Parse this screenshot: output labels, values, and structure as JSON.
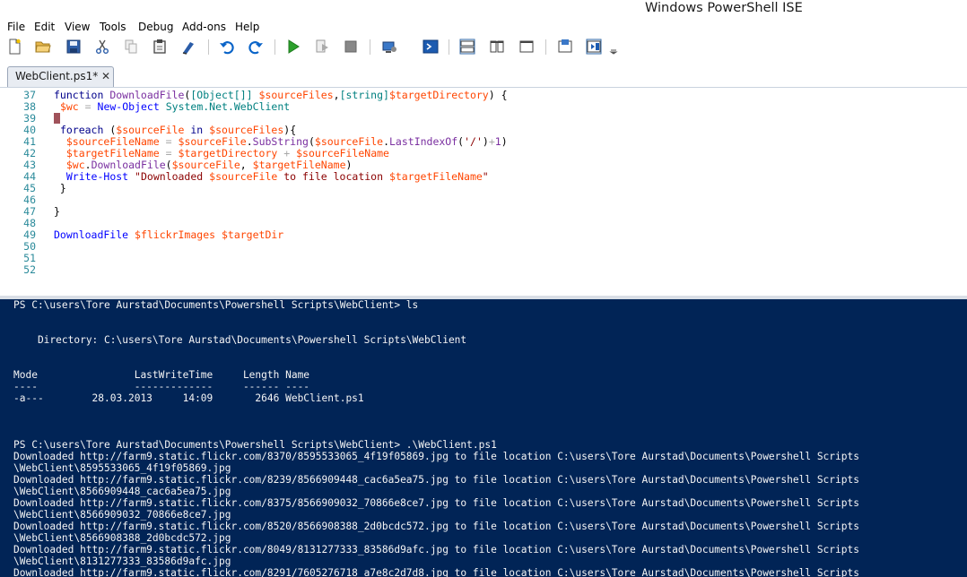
{
  "window": {
    "title": "Windows PowerShell ISE"
  },
  "menu": [
    "File",
    "Edit",
    "View",
    "Tools",
    "Debug",
    "Add-ons",
    "Help"
  ],
  "toolbar": {
    "buttons": [
      "new-file-icon",
      "open-folder-icon",
      "save-icon",
      "cut-icon",
      "copy-icon",
      "paste-icon",
      "clear-console-icon",
      "undo-icon",
      "redo-icon",
      "run-script-icon",
      "run-selection-icon",
      "stop-icon",
      "new-remote-tab-icon",
      "start-powershell-icon",
      "show-script-top-icon",
      "show-script-right-icon",
      "show-script-maximized-icon",
      "show-command-window-icon",
      "show-command-addon-icon",
      "toolbar-overflow-icon"
    ],
    "accent": "#0a64c8"
  },
  "tab": {
    "label": "WebClient.ps1*",
    "close": "✕"
  },
  "editor": {
    "line_numbers": [
      "37",
      "38",
      "39",
      "40",
      "41",
      "42",
      "43",
      "44",
      "45",
      "46",
      "47",
      "48",
      "49",
      "50",
      "51",
      "52"
    ],
    "lines": [
      [
        [
          "kw",
          "function "
        ],
        [
          "fn",
          "DownloadFile"
        ],
        [
          "pl",
          "("
        ],
        [
          "ty",
          "[Object[]]"
        ],
        [
          "pl",
          " "
        ],
        [
          "vr",
          "$sourceFiles"
        ],
        [
          "pl",
          ","
        ],
        [
          "ty",
          "[string]"
        ],
        [
          "vr",
          "$targetDirectory"
        ],
        [
          "pl",
          ") {"
        ]
      ],
      [
        [
          "pl",
          " "
        ],
        [
          "vr",
          "$wc"
        ],
        [
          "pl",
          " "
        ],
        [
          "op",
          "="
        ],
        [
          "pl",
          " "
        ],
        [
          "cm",
          "New-Object"
        ],
        [
          "pl",
          " "
        ],
        [
          "ty",
          "System.Net.WebClient"
        ]
      ],
      [],
      [
        [
          "pl",
          " "
        ],
        [
          "kw",
          "foreach"
        ],
        [
          "pl",
          " ("
        ],
        [
          "vr",
          "$sourceFile"
        ],
        [
          "pl",
          " "
        ],
        [
          "kw",
          "in"
        ],
        [
          "pl",
          " "
        ],
        [
          "vr",
          "$sourceFiles"
        ],
        [
          "pl",
          "){"
        ]
      ],
      [
        [
          "pl",
          "  "
        ],
        [
          "vr",
          "$sourceFileName"
        ],
        [
          "pl",
          " "
        ],
        [
          "op",
          "="
        ],
        [
          "pl",
          " "
        ],
        [
          "vr",
          "$sourceFile"
        ],
        [
          "pl",
          "."
        ],
        [
          "fn",
          "SubString"
        ],
        [
          "pl",
          "("
        ],
        [
          "vr",
          "$sourceFile"
        ],
        [
          "pl",
          "."
        ],
        [
          "fn",
          "LastIndexOf"
        ],
        [
          "pl",
          "("
        ],
        [
          "st",
          "'/'"
        ],
        [
          "pl",
          ")"
        ],
        [
          "op",
          "+"
        ],
        [
          "fn",
          "1"
        ],
        [
          "pl",
          ")"
        ]
      ],
      [
        [
          "pl",
          "  "
        ],
        [
          "vr",
          "$targetFileName"
        ],
        [
          "pl",
          " "
        ],
        [
          "op",
          "="
        ],
        [
          "pl",
          " "
        ],
        [
          "vr",
          "$targetDirectory"
        ],
        [
          "pl",
          " "
        ],
        [
          "op",
          "+"
        ],
        [
          "pl",
          " "
        ],
        [
          "vr",
          "$sourceFileName"
        ]
      ],
      [
        [
          "pl",
          "  "
        ],
        [
          "vr",
          "$wc"
        ],
        [
          "pl",
          "."
        ],
        [
          "fn",
          "DownloadFile"
        ],
        [
          "pl",
          "("
        ],
        [
          "vr",
          "$sourceFile"
        ],
        [
          "pl",
          ", "
        ],
        [
          "vr",
          "$targetFileName"
        ],
        [
          "pl",
          ")"
        ]
      ],
      [
        [
          "pl",
          "  "
        ],
        [
          "cm",
          "Write-Host"
        ],
        [
          "pl",
          " "
        ],
        [
          "st",
          "\"Downloaded "
        ],
        [
          "vr",
          "$sourceFile"
        ],
        [
          "st",
          " to file location "
        ],
        [
          "vr",
          "$targetFileName"
        ],
        [
          "st",
          "\""
        ]
      ],
      [
        [
          "pl",
          " }"
        ]
      ],
      [],
      [
        [
          "pl",
          "}"
        ]
      ],
      [],
      [
        [
          "cm",
          "DownloadFile"
        ],
        [
          "pl",
          " "
        ],
        [
          "vr",
          "$flickrImages"
        ],
        [
          "pl",
          " "
        ],
        [
          "vr",
          "$targetDir"
        ]
      ],
      [],
      [],
      []
    ]
  },
  "console": {
    "lines": [
      "PS C:\\users\\Tore Aurstad\\Documents\\Powershell Scripts\\WebClient> ls",
      "",
      "",
      "    Directory: C:\\users\\Tore Aurstad\\Documents\\Powershell Scripts\\WebClient",
      "",
      "",
      "Mode                LastWriteTime     Length Name",
      "----                -------------     ------ ----",
      "-a---        28.03.2013     14:09       2646 WebClient.ps1",
      "",
      "",
      "",
      "PS C:\\users\\Tore Aurstad\\Documents\\Powershell Scripts\\WebClient> .\\WebClient.ps1",
      "Downloaded http://farm9.static.flickr.com/8370/8595533065_4f19f05869.jpg to file location C:\\users\\Tore Aurstad\\Documents\\Powershell Scripts",
      "\\WebClient\\8595533065_4f19f05869.jpg",
      "Downloaded http://farm9.static.flickr.com/8239/8566909448_cac6a5ea75.jpg to file location C:\\users\\Tore Aurstad\\Documents\\Powershell Scripts",
      "\\WebClient\\8566909448_cac6a5ea75.jpg",
      "Downloaded http://farm9.static.flickr.com/8375/8566909032_70866e8ce7.jpg to file location C:\\users\\Tore Aurstad\\Documents\\Powershell Scripts",
      "\\WebClient\\8566909032_70866e8ce7.jpg",
      "Downloaded http://farm9.static.flickr.com/8520/8566908388_2d0bcdc572.jpg to file location C:\\users\\Tore Aurstad\\Documents\\Powershell Scripts",
      "\\WebClient\\8566908388_2d0bcdc572.jpg",
      "Downloaded http://farm9.static.flickr.com/8049/8131277333_83586d9afc.jpg to file location C:\\users\\Tore Aurstad\\Documents\\Powershell Scripts",
      "\\WebClient\\8131277333_83586d9afc.jpg",
      "Downloaded http://farm9.static.flickr.com/8291/7605276718_a7e8c2d7d8.jpg to file location C:\\users\\Tore Aurstad\\Documents\\Powershell Scripts"
    ],
    "background": "#012456",
    "foreground": "#f5f5f5"
  }
}
